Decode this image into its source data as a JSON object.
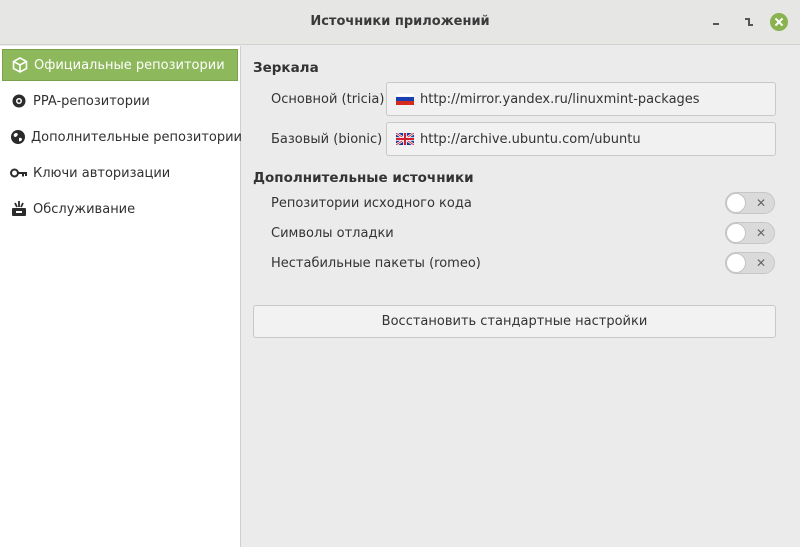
{
  "window": {
    "title": "Источники приложений",
    "close_color": "#8ab24e"
  },
  "sidebar": {
    "active_color": "#8db85b",
    "items": [
      {
        "label": "Официальные репозитории",
        "icon": "package-icon",
        "active": true
      },
      {
        "label": "PPA-репозитории",
        "icon": "ppa-disc-icon",
        "active": false
      },
      {
        "label": "Дополнительные репозитории",
        "icon": "globe-icon",
        "active": false
      },
      {
        "label": "Ключи авторизации",
        "icon": "key-icon",
        "active": false
      },
      {
        "label": "Обслуживание",
        "icon": "maintenance-icon",
        "active": false
      }
    ]
  },
  "main": {
    "mirrors": {
      "title": "Зеркала",
      "rows": [
        {
          "label": "Основной (tricia)",
          "url": "http://mirror.yandex.ru/linuxmint-packages",
          "flag": "russia-flag-icon"
        },
        {
          "label": "Базовый (bionic)",
          "url": "http://archive.ubuntu.com/ubuntu",
          "flag": "uk-flag-icon"
        }
      ]
    },
    "extra": {
      "title": "Дополнительные источники",
      "toggles": [
        {
          "label": "Репозитории исходного кода",
          "enabled": false
        },
        {
          "label": "Символы отладки",
          "enabled": false
        },
        {
          "label": "Нестабильные пакеты (romeo)",
          "enabled": false
        }
      ],
      "toggle_off_glyph": "✕"
    },
    "reset_label": "Восстановить стандартные настройки"
  }
}
